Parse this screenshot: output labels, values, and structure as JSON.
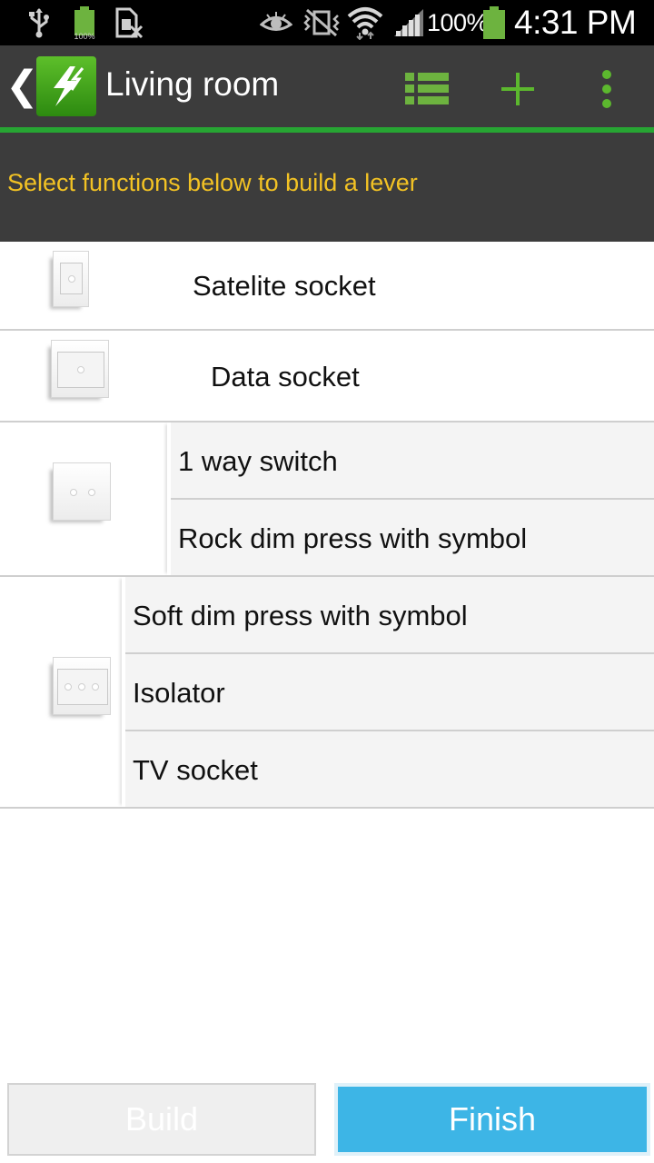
{
  "status_bar": {
    "battery_small_label": "100%",
    "battery_percent": "100%",
    "time": "4:31 PM",
    "icons": [
      "usb-icon",
      "battery-full-icon",
      "sim-blocked-icon",
      "eye-icon",
      "vibrate-mute-icon",
      "wifi-icon",
      "signal-icon",
      "battery-icon"
    ]
  },
  "action_bar": {
    "title": "Living room",
    "back_icon": "chevron-left-icon",
    "app_icon": "lightning-app-icon",
    "actions": [
      "list-icon",
      "add-icon",
      "more-vert-icon"
    ],
    "accent_color": "#27a533"
  },
  "hint": {
    "text": "Select functions below to build a lever",
    "color": "#f2c224"
  },
  "list": {
    "rows": [
      {
        "icon": "plate-1-dot",
        "items": [
          "Satelite socket"
        ]
      },
      {
        "icon": "plate-1-dot-wide",
        "items": [
          "Data socket"
        ]
      },
      {
        "icon": "plate-2-dot",
        "items": [
          "1 way switch",
          "Rock dim press with symbol"
        ]
      },
      {
        "icon": "plate-3-dot",
        "items": [
          "Soft dim press with symbol",
          "Isolator",
          "TV socket"
        ]
      }
    ]
  },
  "buttons": {
    "build": "Build",
    "finish": "Finish",
    "finish_color": "#3db5e6"
  }
}
